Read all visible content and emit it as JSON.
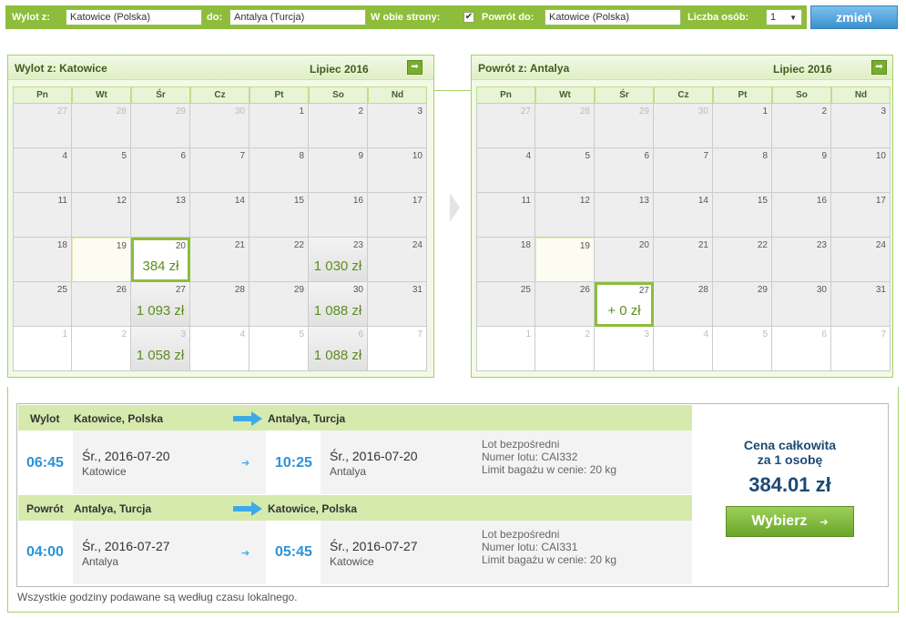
{
  "search": {
    "from_label": "Wylot z:",
    "from_value": "Katowice (Polska)",
    "to_label": "do:",
    "to_value": "Antalya (Turcja)",
    "roundtrip_label": "W obie strony:",
    "roundtrip_check": "✔",
    "return_label": "Powrót do:",
    "return_value": "Katowice (Polska)",
    "persons_label": "Liczba osób:",
    "persons_value": "1",
    "persons_arrow": "▼",
    "change_button": "zmień"
  },
  "weekdays": [
    "Pn",
    "Wt",
    "Śr",
    "Cz",
    "Pt",
    "So",
    "Nd"
  ],
  "outbound_calendar": {
    "title_prefix": "Wylot z:",
    "title_city": "Katowice",
    "month": "Lipiec 2016",
    "next_icon": "➡",
    "days": [
      {
        "n": "27",
        "other": true
      },
      {
        "n": "28",
        "other": true
      },
      {
        "n": "29",
        "other": true
      },
      {
        "n": "30",
        "other": true
      },
      {
        "n": "1"
      },
      {
        "n": "2"
      },
      {
        "n": "3"
      },
      {
        "n": "4"
      },
      {
        "n": "5"
      },
      {
        "n": "6"
      },
      {
        "n": "7"
      },
      {
        "n": "8"
      },
      {
        "n": "9"
      },
      {
        "n": "10"
      },
      {
        "n": "11"
      },
      {
        "n": "12"
      },
      {
        "n": "13"
      },
      {
        "n": "14"
      },
      {
        "n": "15"
      },
      {
        "n": "16"
      },
      {
        "n": "17"
      },
      {
        "n": "18"
      },
      {
        "n": "19",
        "faint": true
      },
      {
        "n": "20",
        "price": "384 zł",
        "selected": true
      },
      {
        "n": "21"
      },
      {
        "n": "22"
      },
      {
        "n": "23",
        "price": "1 030 zł"
      },
      {
        "n": "24"
      },
      {
        "n": "25"
      },
      {
        "n": "26"
      },
      {
        "n": "27",
        "price": "1 093 zł"
      },
      {
        "n": "28"
      },
      {
        "n": "29"
      },
      {
        "n": "30",
        "price": "1 088 zł"
      },
      {
        "n": "31"
      },
      {
        "n": "1",
        "other": true,
        "white": true
      },
      {
        "n": "2",
        "other": true,
        "white": true
      },
      {
        "n": "3",
        "other": true,
        "price": "1 058 zł"
      },
      {
        "n": "4",
        "other": true,
        "white": true
      },
      {
        "n": "5",
        "other": true,
        "white": true
      },
      {
        "n": "6",
        "other": true,
        "price": "1 088 zł"
      },
      {
        "n": "7",
        "other": true,
        "white": true
      }
    ]
  },
  "return_calendar": {
    "title_prefix": "Powrót z:",
    "title_city": "Antalya",
    "month": "Lipiec 2016",
    "next_icon": "➡",
    "days": [
      {
        "n": "27",
        "other": true
      },
      {
        "n": "28",
        "other": true
      },
      {
        "n": "29",
        "other": true
      },
      {
        "n": "30",
        "other": true
      },
      {
        "n": "1"
      },
      {
        "n": "2"
      },
      {
        "n": "3"
      },
      {
        "n": "4"
      },
      {
        "n": "5"
      },
      {
        "n": "6"
      },
      {
        "n": "7"
      },
      {
        "n": "8"
      },
      {
        "n": "9"
      },
      {
        "n": "10"
      },
      {
        "n": "11"
      },
      {
        "n": "12"
      },
      {
        "n": "13"
      },
      {
        "n": "14"
      },
      {
        "n": "15"
      },
      {
        "n": "16"
      },
      {
        "n": "17"
      },
      {
        "n": "18"
      },
      {
        "n": "19",
        "faint": true
      },
      {
        "n": "20"
      },
      {
        "n": "21"
      },
      {
        "n": "22"
      },
      {
        "n": "23"
      },
      {
        "n": "24"
      },
      {
        "n": "25"
      },
      {
        "n": "26"
      },
      {
        "n": "27",
        "price": "+ 0 zł",
        "selected": true
      },
      {
        "n": "28"
      },
      {
        "n": "29"
      },
      {
        "n": "30"
      },
      {
        "n": "31"
      },
      {
        "n": "1",
        "other": true,
        "white": true
      },
      {
        "n": "2",
        "other": true,
        "white": true
      },
      {
        "n": "3",
        "other": true,
        "white": true
      },
      {
        "n": "4",
        "other": true,
        "white": true
      },
      {
        "n": "5",
        "other": true,
        "white": true
      },
      {
        "n": "6",
        "other": true,
        "white": true
      },
      {
        "n": "7",
        "other": true,
        "white": true
      }
    ]
  },
  "outbound": {
    "label": "Wylot",
    "from": "Katowice, Polska",
    "to": "Antalya, Turcja",
    "dep_time": "06:45",
    "dep_date": "Śr., 2016-07-20",
    "dep_city": "Katowice",
    "arrow": "➔",
    "arr_time": "10:25",
    "arr_date": "Śr., 2016-07-20",
    "arr_city": "Antalya",
    "info1": "Lot bezpośredni",
    "info2": "Numer lotu: CAI332",
    "info3": "Limit bagażu w cenie: 20 kg"
  },
  "return": {
    "label": "Powrót",
    "from": "Antalya, Turcja",
    "to": "Katowice, Polska",
    "dep_time": "04:00",
    "dep_date": "Śr., 2016-07-27",
    "dep_city": "Antalya",
    "arrow": "➔",
    "arr_time": "05:45",
    "arr_date": "Śr., 2016-07-27",
    "arr_city": "Katowice",
    "info1": "Lot bezpośredni",
    "info2": "Numer lotu: CAI331",
    "info3": "Limit bagażu w cenie: 20 kg"
  },
  "price": {
    "label_line1": "Cena całkowita",
    "label_line2": "za 1 osobę",
    "value": "384.01 zł",
    "select_button": "Wybierz",
    "select_arrow": "➔"
  },
  "footnote": "Wszystkie godziny podawane są według czasu lokalnego.",
  "colors": {
    "accent_green": "#8dbd3a",
    "price_green": "#5e8d1f",
    "time_blue": "#2c93d6",
    "price_navy": "#1d4a73"
  }
}
